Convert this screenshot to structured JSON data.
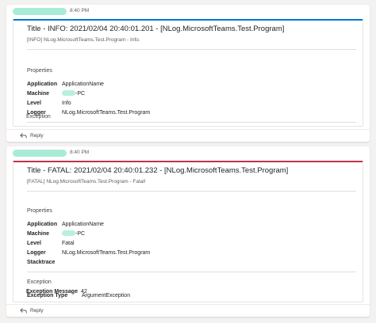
{
  "messages": [
    {
      "time": "8:40 PM",
      "accent": "#0078d4",
      "title": "Title - INFO: 2021/02/04 20:40:01.201 - [NLog.MicrosoftTeams.Test.Program]",
      "subtitle": "[INFO] NLog.MicrosoftTeams.Test.Program - Info.",
      "properties_label": "Properties",
      "facts": [
        {
          "key": "Application",
          "value": "ApplicationName"
        },
        {
          "key": "Machine",
          "value": "-PC"
        },
        {
          "key": "Level",
          "value": "Info"
        },
        {
          "key": "Logger",
          "value": "NLog.MicrosoftTeams.Test.Program"
        }
      ],
      "exception_label": "Exception",
      "reply_label": "Reply"
    },
    {
      "time": "8:40 PM",
      "accent": "#c4314b",
      "title": "Title - FATAL: 2021/02/04 20:40:01.232 - [NLog.MicrosoftTeams.Test.Program]",
      "subtitle": "[FATAL] NLog.MicrosoftTeams.Test.Program - Fatal!",
      "properties_label": "Properties",
      "facts": [
        {
          "key": "Application",
          "value": "ApplicationName"
        },
        {
          "key": "Machine",
          "value": "-PC"
        },
        {
          "key": "Level",
          "value": "Fatal"
        },
        {
          "key": "Logger",
          "value": "NLog.MicrosoftTeams.Test.Program"
        },
        {
          "key": "Stacktrace",
          "value": ""
        }
      ],
      "exception_label": "Exception",
      "exception_facts": [
        {
          "key": "Exception Type",
          "value": "ArgumentException"
        },
        {
          "key": "Exception Message",
          "value": "42"
        }
      ],
      "reply_label": "Reply"
    }
  ],
  "icons": {
    "reply": "reply-arrow-icon"
  }
}
